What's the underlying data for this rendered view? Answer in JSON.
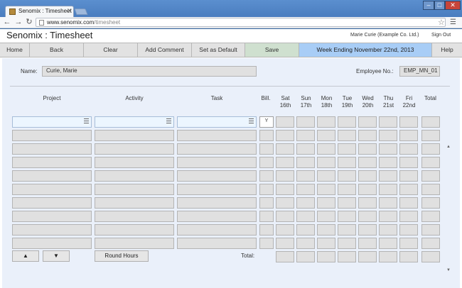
{
  "browser": {
    "tab_title": "Senomix : Timesheet",
    "url_host": "www.senomix.com",
    "url_path": "/timesheet"
  },
  "header": {
    "app_title": "Senomix : Timesheet",
    "user": "Marie Curie  (Example Co. Ltd.)",
    "sign_out": "Sign Out"
  },
  "nav": {
    "home": "Home",
    "back": "Back",
    "clear": "Clear",
    "add_comment": "Add Comment",
    "set_default": "Set as Default",
    "save": "Save",
    "week_ending": "Week Ending November 22nd, 2013",
    "help": "Help"
  },
  "form": {
    "name_label": "Name:",
    "name_value": "Curie, Marie",
    "employee_label": "Employee No.:",
    "employee_value": "EMP_MN_01"
  },
  "columns": {
    "project": "Project",
    "activity": "Activity",
    "task": "Task",
    "bill": "Bill.",
    "days": [
      {
        "day": "Sat",
        "date": "16th"
      },
      {
        "day": "Sun",
        "date": "17th"
      },
      {
        "day": "Mon",
        "date": "18th"
      },
      {
        "day": "Tue",
        "date": "19th"
      },
      {
        "day": "Wed",
        "date": "20th"
      },
      {
        "day": "Thu",
        "date": "21st"
      },
      {
        "day": "Fri",
        "date": "22nd"
      }
    ],
    "total": "Total"
  },
  "first_row": {
    "bill_value": "Y"
  },
  "footer": {
    "up_arrow": "▲",
    "down_arrow": "▼",
    "round_hours": "Round Hours",
    "total_label": "Total:"
  },
  "colors": {
    "week_ending_bg": "#a8cdf6",
    "save_bg": "#cfe0cf",
    "content_bg": "#eaf0fa"
  }
}
